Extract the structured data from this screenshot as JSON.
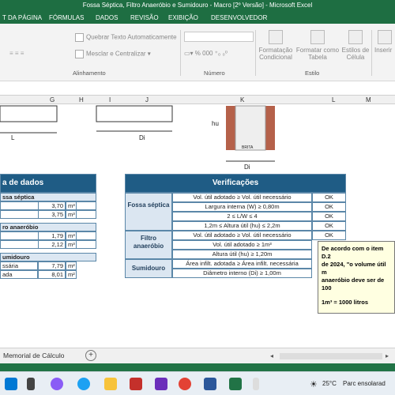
{
  "window": {
    "title": "Fossa Séptica, Filtro Anaeróbio e Sumidouro - Macro [2º Versão] - Microsoft Excel"
  },
  "menu": [
    "T DA PÁGINA",
    "FÓRMULAS",
    "DADOS",
    "REVISÃO",
    "EXIBIÇÃO",
    "DESENVOLVEDOR"
  ],
  "ribbon": {
    "wrap_text": "Quebrar Texto Automaticamente",
    "merge_center": "Mesclar e Centralizar",
    "alignment_group": "Alinhamento",
    "number_group": "Número",
    "number_symbols": "% 000",
    "cond_format": [
      "Formatação",
      "Condicional"
    ],
    "format_table": [
      "Formatar como",
      "Tabela"
    ],
    "cell_styles": [
      "Estilos de",
      "Célula"
    ],
    "style_group": "Estilo",
    "insert": "Inserir"
  },
  "columns": [
    "G",
    "H",
    "I",
    "J",
    "K",
    "L",
    "M"
  ],
  "drawing": {
    "label_L": "L",
    "label_Di_1": "Di",
    "label_hu": "hu",
    "label_Di_2": "Di",
    "brita": "BRITA"
  },
  "left_table": {
    "title": "a de dados",
    "sections": [
      {
        "header": "ssa séptica",
        "rows": [
          {
            "value": "3,70",
            "unit": "m³"
          },
          {
            "value": "3,75",
            "unit": "m³"
          }
        ]
      },
      {
        "header": "ro anaeróbio",
        "rows": [
          {
            "value": "1,79",
            "unit": "m³"
          },
          {
            "value": "2,12",
            "unit": "m³"
          }
        ]
      },
      {
        "header": "umidouro",
        "rows": [
          {
            "label": "ssária",
            "value": "7,79",
            "unit": "m²"
          },
          {
            "label": "ada",
            "value": "8,01",
            "unit": "m²"
          }
        ]
      }
    ]
  },
  "verif": {
    "title": "Verificações",
    "groups": [
      {
        "label": "Fossa séptica",
        "rows": [
          {
            "text": "Vol. útil adotado ≥ Vol. útil necessário",
            "status": "OK"
          },
          {
            "text": "Largura interna (W) ≥ 0,80m",
            "status": "OK"
          },
          {
            "text": "2 ≤ L/W ≤ 4",
            "status": "OK"
          },
          {
            "text": "1,2m ≤ Altura útil (hu) ≤ 2,2m",
            "status": "OK"
          }
        ]
      },
      {
        "label": "Filtro anaeróbio",
        "rows": [
          {
            "text": "Vol. útil adotado ≥ Vol. útil necessário",
            "status": "OK"
          },
          {
            "text": "Vol. útil adotado ≥ 1m³",
            "status": ""
          },
          {
            "text": "Altura útil (hu) ≥ 1,20m",
            "status": ""
          }
        ]
      },
      {
        "label": "Sumidouro",
        "rows": [
          {
            "text": "Área infilt. adotada ≥ Área infilt. necessária",
            "status": ""
          },
          {
            "text": "Diâmetro interno (Di) ≥ 1,00m",
            "status": ""
          }
        ]
      }
    ]
  },
  "tooltip": {
    "line1": "De acordo com o item D.2",
    "line2": "de 2024, \"o volume útil m",
    "line3": "anaeróbio deve ser de 100",
    "line4": "1m³ = 1000 litros"
  },
  "sheet_tab": "Memorial de Cálculo",
  "taskbar": {
    "temp": "25°C",
    "weather": "Parc ensolarad"
  }
}
